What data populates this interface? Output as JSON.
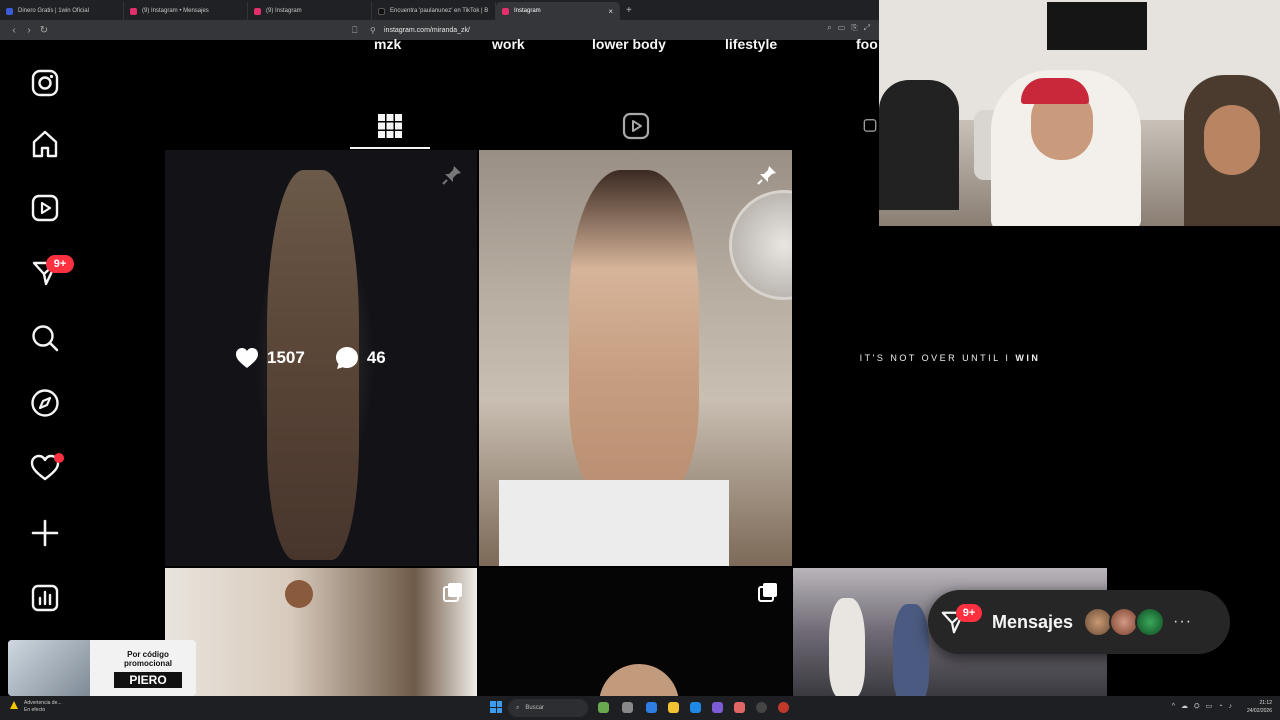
{
  "browser": {
    "tabs": [
      {
        "label": "Dinero Gratis | 1win Oficial",
        "favicon_color": "#3b5bdb",
        "active": false
      },
      {
        "label": "(9) Instagram • Mensajes",
        "favicon_color": "#e1306c",
        "active": false
      },
      {
        "label": "(9) Instagram",
        "favicon_color": "#e1306c",
        "active": false
      },
      {
        "label": "Encuentra 'paulanunez' en TikTok | B",
        "favicon_color": "#111111",
        "active": false
      },
      {
        "label": "Instagram",
        "favicon_color": "#e1306c",
        "active": true
      }
    ],
    "url": "instagram.com/miranda_zk/",
    "newtab_glyph": "+",
    "close_glyph": "×"
  },
  "sidebar": {
    "items": [
      {
        "name": "instagram-logo-icon"
      },
      {
        "name": "home-icon"
      },
      {
        "name": "reels-icon"
      },
      {
        "name": "messages-icon",
        "badge": "9+"
      },
      {
        "name": "search-icon"
      },
      {
        "name": "explore-icon"
      },
      {
        "name": "notifications-icon",
        "dot": true
      },
      {
        "name": "create-icon"
      },
      {
        "name": "dashboard-icon"
      }
    ]
  },
  "highlights": [
    "mzk",
    "work",
    "lower body",
    "lifestyle",
    "foo"
  ],
  "profile_tabs": [
    {
      "name": "posts",
      "icon": "grid-icon",
      "active": true
    },
    {
      "name": "reels",
      "icon": "reels-icon",
      "active": false
    },
    {
      "name": "tagged",
      "icon": "tagged-icon",
      "active": false
    }
  ],
  "posts": {
    "hover_stats": {
      "likes": "1507",
      "comments": "46"
    },
    "quote": {
      "text": "IT'S NOT OVER UNTIL I ",
      "emphasis": "WIN"
    }
  },
  "messages_pill": {
    "label": "Mensajes",
    "badge": "9+",
    "more": "···"
  },
  "promo": {
    "line1": "Por código promocional",
    "code": "PIERO"
  },
  "taskbar": {
    "warning": "Advertencia de...",
    "warning_sub": "En efecto",
    "search_placeholder": "Buscar",
    "time": "21:12",
    "date": "24/02/2026"
  },
  "colors": {
    "badge": "#ff3040",
    "background": "#000000",
    "text": "#f5f5f5"
  }
}
